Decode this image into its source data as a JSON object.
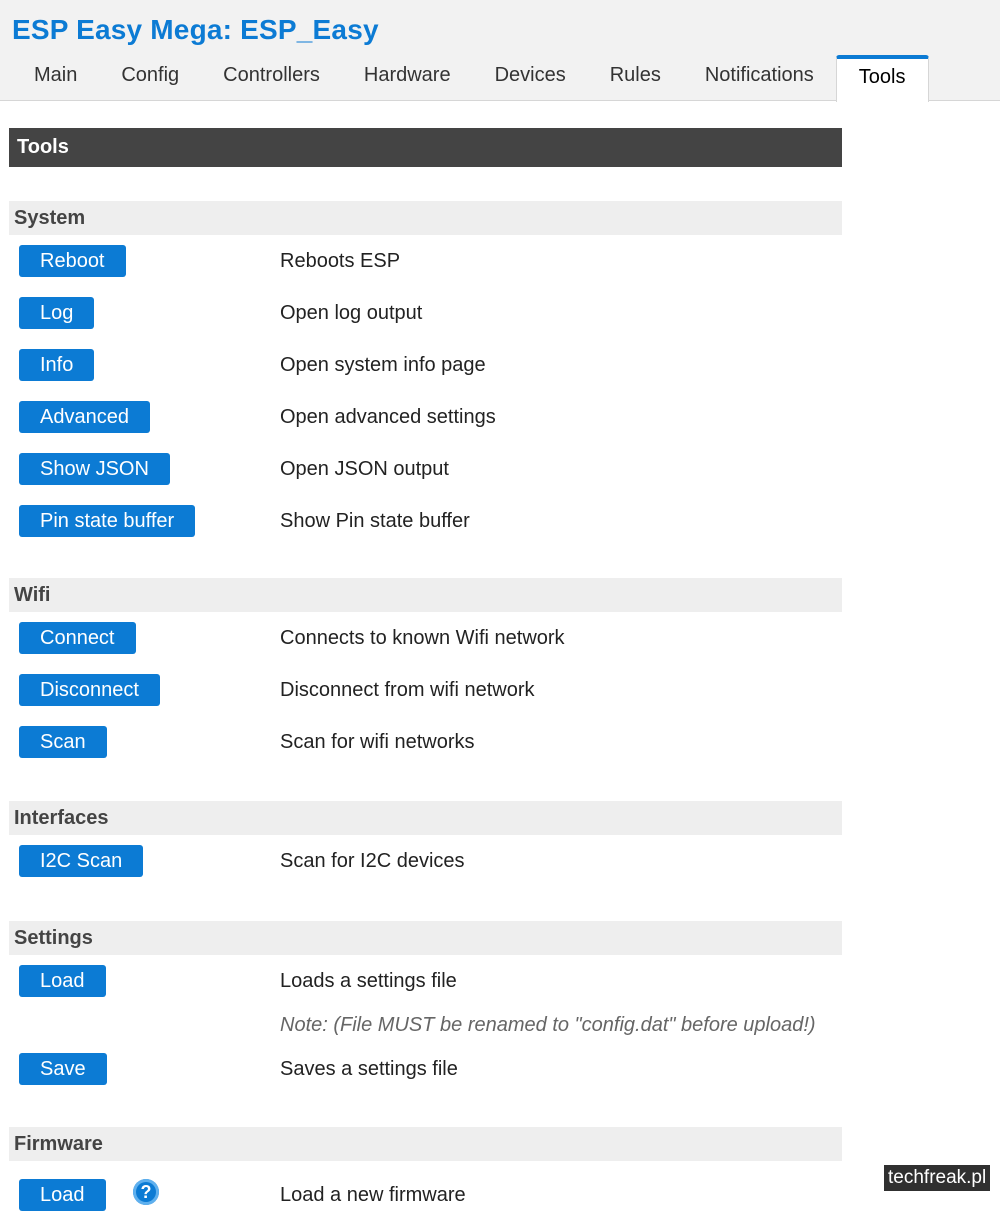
{
  "app": {
    "title": "ESP Easy Mega: ESP_Easy"
  },
  "nav": {
    "tabs": [
      {
        "label": "Main"
      },
      {
        "label": "Config"
      },
      {
        "label": "Controllers"
      },
      {
        "label": "Hardware"
      },
      {
        "label": "Devices"
      },
      {
        "label": "Rules"
      },
      {
        "label": "Notifications"
      },
      {
        "label": "Tools",
        "active": true
      }
    ]
  },
  "page": {
    "heading": "Tools"
  },
  "sections": {
    "system": {
      "title": "System",
      "rows": [
        {
          "button": "Reboot",
          "desc": "Reboots ESP"
        },
        {
          "button": "Log",
          "desc": "Open log output"
        },
        {
          "button": "Info",
          "desc": "Open system info page"
        },
        {
          "button": "Advanced",
          "desc": "Open advanced settings"
        },
        {
          "button": "Show JSON",
          "desc": "Open JSON output"
        },
        {
          "button": "Pin state buffer",
          "desc": "Show Pin state buffer"
        }
      ]
    },
    "wifi": {
      "title": "Wifi",
      "rows": [
        {
          "button": "Connect",
          "desc": "Connects to known Wifi network"
        },
        {
          "button": "Disconnect",
          "desc": "Disconnect from wifi network"
        },
        {
          "button": "Scan",
          "desc": "Scan for wifi networks"
        }
      ]
    },
    "interfaces": {
      "title": "Interfaces",
      "rows": [
        {
          "button": "I2C Scan",
          "desc": "Scan for I2C devices"
        }
      ]
    },
    "settings": {
      "title": "Settings",
      "rows": [
        {
          "button": "Load",
          "desc": "Loads a settings file"
        },
        {
          "button": "Save",
          "desc": "Saves a settings file"
        }
      ],
      "note": "Note: (File MUST be renamed to \"config.dat\" before upload!)"
    },
    "firmware": {
      "title": "Firmware",
      "rows": [
        {
          "button": "Load",
          "desc": "Load a new firmware",
          "help_icon": "?"
        }
      ]
    }
  },
  "watermark": "techfreak.pl",
  "colors": {
    "accent": "#0c7bd4",
    "bar": "#444444",
    "section_bg": "#eeeeee"
  }
}
